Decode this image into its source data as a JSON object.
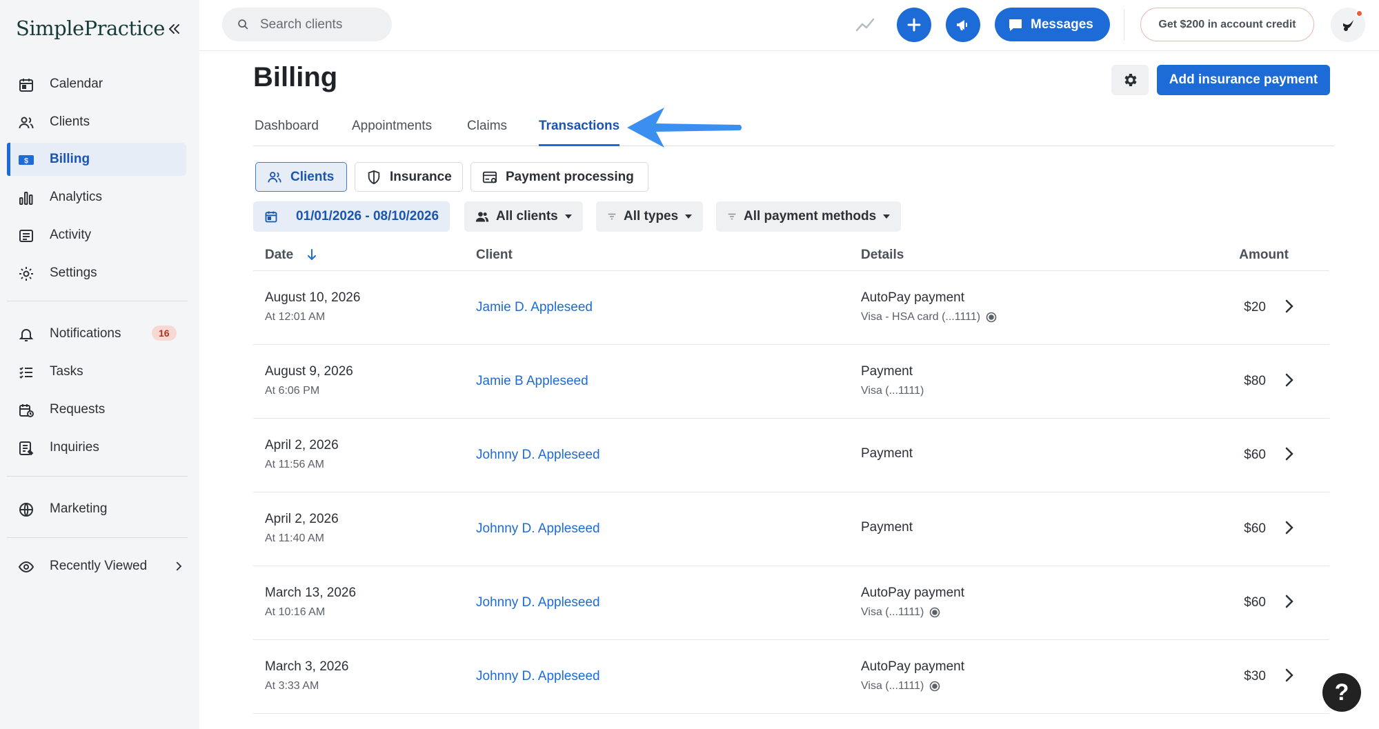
{
  "sidebar": {
    "logo": "SimplePractice",
    "items": [
      {
        "label": "Calendar",
        "icon": "calendar-icon"
      },
      {
        "label": "Clients",
        "icon": "clients-icon"
      },
      {
        "label": "Billing",
        "icon": "billing-icon",
        "active": true
      },
      {
        "label": "Analytics",
        "icon": "analytics-icon"
      },
      {
        "label": "Activity",
        "icon": "activity-icon"
      },
      {
        "label": "Settings",
        "icon": "gear-icon"
      }
    ],
    "items2": [
      {
        "label": "Notifications",
        "icon": "bell-icon",
        "badge": "16"
      },
      {
        "label": "Tasks",
        "icon": "tasks-icon"
      },
      {
        "label": "Requests",
        "icon": "requests-icon"
      },
      {
        "label": "Inquiries",
        "icon": "inquiries-icon"
      }
    ],
    "marketing": "Marketing",
    "recently_viewed": "Recently Viewed"
  },
  "topbar": {
    "search_placeholder": "Search clients",
    "messages_label": "Messages",
    "credit_label": "Get $200 in account credit"
  },
  "page": {
    "title": "Billing",
    "add_insurance_label": "Add insurance payment",
    "tabs": [
      "Dashboard",
      "Appointments",
      "Claims",
      "Transactions"
    ],
    "active_tab": "Transactions",
    "subtabs": [
      "Clients",
      "Insurance",
      "Payment processing"
    ],
    "filters": {
      "date_range": "01/01/2026 - 08/10/2026",
      "clients": "All clients",
      "types": "All types",
      "methods": "All payment methods"
    }
  },
  "table": {
    "headers": {
      "date": "Date",
      "client": "Client",
      "details": "Details",
      "amount": "Amount"
    },
    "rows": [
      {
        "date": "August 10, 2026",
        "time": "At 12:01 AM",
        "client": "Jamie D. Appleseed",
        "detail": "AutoPay payment",
        "sub": "Visa - HSA card (...1111)",
        "autopay": true,
        "amount": "$20"
      },
      {
        "date": "August 9, 2026",
        "time": "At 6:06 PM",
        "client": "Jamie B Appleseed",
        "detail": "Payment",
        "sub": "Visa (...1111)",
        "autopay": false,
        "amount": "$80"
      },
      {
        "date": "April 2, 2026",
        "time": "At 11:56 AM",
        "client": "Johnny D. Appleseed",
        "detail": "Payment",
        "sub": "",
        "autopay": false,
        "amount": "$60"
      },
      {
        "date": "April 2, 2026",
        "time": "At 11:40 AM",
        "client": "Johnny D. Appleseed",
        "detail": "Payment",
        "sub": "",
        "autopay": false,
        "amount": "$60"
      },
      {
        "date": "March 13, 2026",
        "time": "At 10:16 AM",
        "client": "Johnny D. Appleseed",
        "detail": "AutoPay payment",
        "sub": "Visa (...1111)",
        "autopay": true,
        "amount": "$60"
      },
      {
        "date": "March 3, 2026",
        "time": "At 3:33 AM",
        "client": "Johnny D. Appleseed",
        "detail": "AutoPay payment",
        "sub": "Visa (...1111)",
        "autopay": true,
        "amount": "$30"
      }
    ]
  },
  "help_label": "?",
  "colors": {
    "accent": "#1c6bd6",
    "badge_bg": "#f8d8d2",
    "badge_text": "#b0341b"
  }
}
